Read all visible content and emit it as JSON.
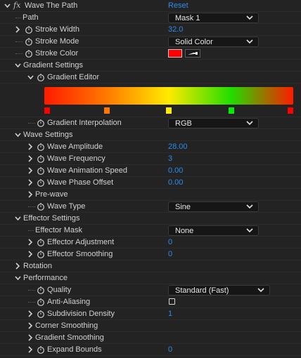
{
  "effect": {
    "fx_symbol": "fx",
    "name": "Wave The Path",
    "reset_label": "Reset"
  },
  "path": {
    "label": "Path",
    "value": "Mask 1"
  },
  "stroke_width": {
    "label": "Stroke Width",
    "value": "32.0"
  },
  "stroke_mode": {
    "label": "Stroke Mode",
    "value": "Solid Color"
  },
  "stroke_color": {
    "label": "Stroke Color",
    "color": "#ff0000"
  },
  "gradient_settings": {
    "label": "Gradient Settings",
    "editor_label": "Gradient Editor",
    "colors": [
      "#ff1a00",
      "#ff7a00",
      "#ffea00",
      "#22dd00",
      "#ff1a00"
    ],
    "stops": [
      {
        "position": 0.005,
        "color": "#ff0000"
      },
      {
        "position": 0.25,
        "color": "#ff7700"
      },
      {
        "position": 0.5,
        "color": "#ffee00"
      },
      {
        "position": 0.75,
        "color": "#00ee00"
      },
      {
        "position": 0.995,
        "color": "#ff0000"
      }
    ],
    "interpolation_label": "Gradient Interpolation",
    "interpolation_value": "RGB"
  },
  "wave_settings": {
    "label": "Wave Settings",
    "amplitude": {
      "label": "Wave Amplitude",
      "value": "28.00"
    },
    "frequency": {
      "label": "Wave Frequency",
      "value": "3"
    },
    "animation_speed": {
      "label": "Wave Animation Speed",
      "value": "0.00"
    },
    "phase_offset": {
      "label": "Wave Phase Offset",
      "value": "0.00"
    },
    "prewave_label": "Pre-wave",
    "wave_type": {
      "label": "Wave Type",
      "value": "Sine"
    }
  },
  "effector_settings": {
    "label": "Effector Settings",
    "mask": {
      "label": "Effector Mask",
      "value": "None"
    },
    "adjustment": {
      "label": "Effector Adjustment",
      "value": "0"
    },
    "smoothing": {
      "label": "Effector Smoothing",
      "value": "0"
    }
  },
  "rotation": {
    "label": "Rotation"
  },
  "performance": {
    "label": "Performance",
    "quality": {
      "label": "Quality",
      "value": "Standard (Fast)"
    },
    "anti_aliasing": {
      "label": "Anti-Aliasing",
      "checked": false
    },
    "subdivision_density": {
      "label": "Subdivision Density",
      "value": "1"
    },
    "corner_smoothing_label": "Corner Smoothing",
    "gradient_smoothing_label": "Gradient Smoothing",
    "expand_bounds": {
      "label": "Expand Bounds",
      "value": "0"
    }
  },
  "colors": {
    "value_blue": "#2d8ceb",
    "panel_bg": "#232323"
  }
}
